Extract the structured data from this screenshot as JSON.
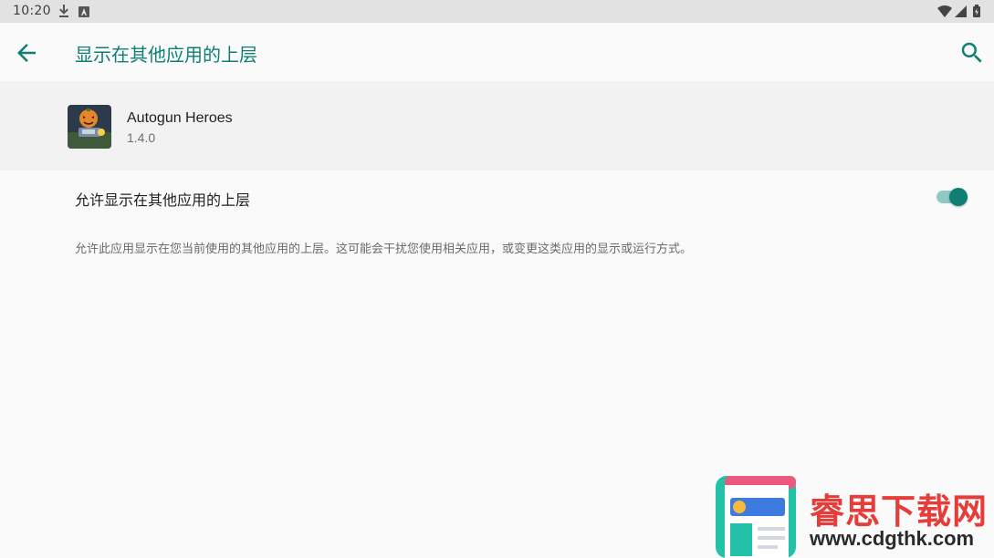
{
  "status_bar": {
    "time": "10:20",
    "icons": [
      "download-icon",
      "notification-a-icon",
      "wifi-icon",
      "signal-icon",
      "battery-icon"
    ]
  },
  "app_bar": {
    "title": "显示在其他应用的上层",
    "back_icon": "arrow-back-icon",
    "search_icon": "search-icon",
    "accent_color": "#0f7f73"
  },
  "app_info": {
    "name": "Autogun Heroes",
    "version": "1.4.0"
  },
  "permission": {
    "label": "允许显示在其他应用的上层",
    "enabled": true,
    "description": "允许此应用显示在您当前使用的其他应用的上层。这可能会干扰您使用相关应用，或变更这类应用的显示或运行方式。"
  },
  "watermark": {
    "brand": "睿思下载网",
    "url": "www.cdgthk.com"
  }
}
